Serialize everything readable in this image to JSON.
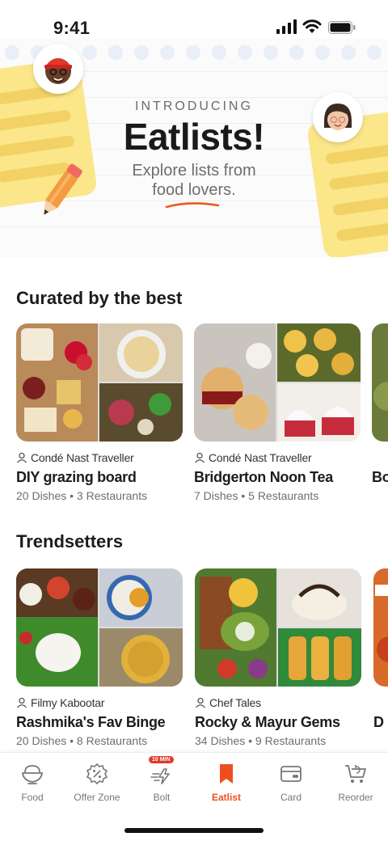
{
  "status_bar": {
    "time": "9:41"
  },
  "hero": {
    "kicker": "INTRODUCING",
    "title": "Eatlists!",
    "subtitle_line1": "Explore lists from",
    "subtitle_line2": "food lovers."
  },
  "sections": [
    {
      "title": "Curated by the best",
      "cards": [
        {
          "author": "Condé Nast Traveller",
          "name": "DIY grazing board",
          "meta": "20 Dishes • 3 Restaurants"
        },
        {
          "author": "Condé Nast Traveller",
          "name": "Bridgerton Noon Tea",
          "meta": "7 Dishes • 5 Restaurants"
        },
        {
          "author": "",
          "name": "Bo",
          "meta": ""
        }
      ]
    },
    {
      "title": "Trendsetters",
      "cards": [
        {
          "author": "Filmy Kabootar",
          "name": "Rashmika's Fav Binge",
          "meta": "20 Dishes • 8 Restaurants"
        },
        {
          "author": "Chef Tales",
          "name": "Rocky & Mayur Gems",
          "meta": "34 Dishes • 9 Restaurants"
        },
        {
          "author": "",
          "name": "D",
          "meta": ""
        }
      ]
    }
  ],
  "nav": {
    "items": [
      {
        "label": "Food",
        "icon": "food-bowl-icon"
      },
      {
        "label": "Offer Zone",
        "icon": "offer-badge-icon"
      },
      {
        "label": "Bolt",
        "icon": "bolt-icon",
        "badge": "10 MIN"
      },
      {
        "label": "Eatlist",
        "icon": "bookmark-icon"
      },
      {
        "label": "Card",
        "icon": "card-icon"
      },
      {
        "label": "Reorder",
        "icon": "reorder-cart-icon"
      }
    ],
    "active_color": "#ef4f1f"
  }
}
